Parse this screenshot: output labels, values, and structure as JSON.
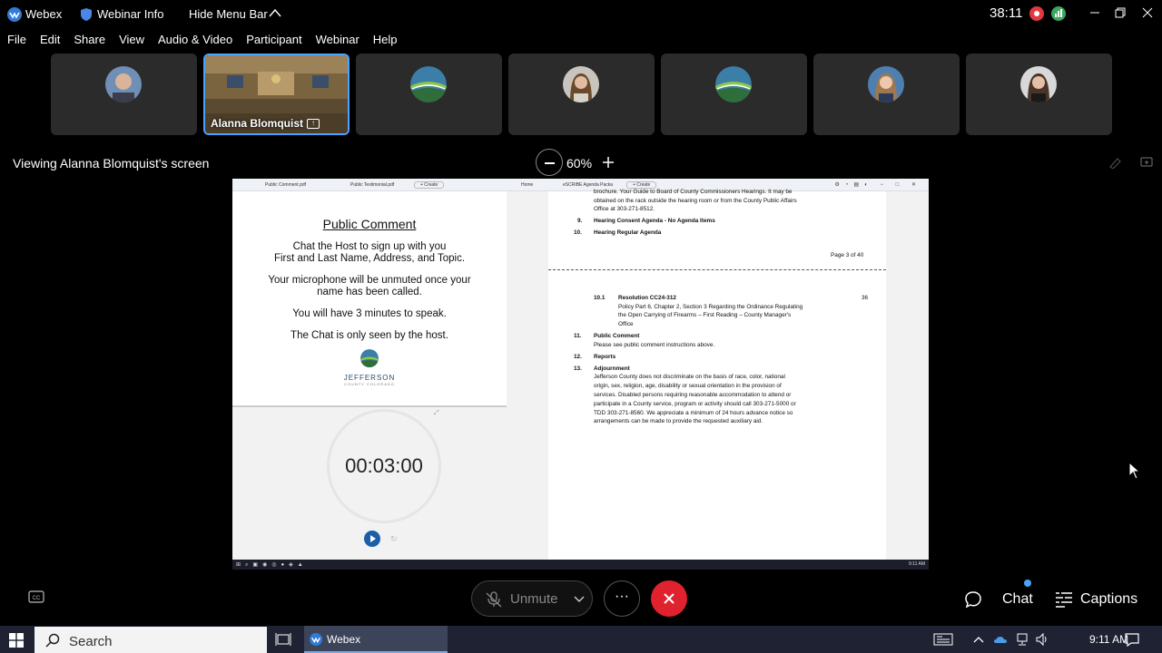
{
  "titlebar": {
    "app_name": "Webex",
    "webinar_info": "Webinar Info",
    "hide_menu": "Hide Menu Bar",
    "elapsed": "38:11"
  },
  "menu": [
    "File",
    "Edit",
    "Share",
    "View",
    "Audio & Video",
    "Participant",
    "Webinar",
    "Help"
  ],
  "participants": {
    "active_name": "Alanna Blomquist"
  },
  "share_view": {
    "viewing_label": "Viewing Alanna Blomquist's screen",
    "zoom": "60%"
  },
  "shared_screen": {
    "left_tabs": [
      "Public Comment.pdf",
      "Public Testimonial.pdf",
      "+ Create"
    ],
    "right_tabs": [
      "Home",
      "eSCRIBE Agenda Packa",
      "+ Create"
    ],
    "public_comment": {
      "title": "Public Comment",
      "p1_l1": "Chat the Host to sign up with you",
      "p1_l2": "First and Last Name, Address, and Topic.",
      "p2_l1": "Your microphone will be unmuted once your",
      "p2_l2": "name has been called.",
      "p3": "You will have 3 minutes to speak.",
      "p4": "The Chat is only seen by the host.",
      "logo_name": "JEFFERSON",
      "logo_sub": "COUNTY COLORADO"
    },
    "timer": "00:03:00",
    "agenda": {
      "top_l1": "brochure.   Your Guide to Board of County Commissioners Hearings.  It may be",
      "top_l2": "obtained on the rack outside the hearing room or from the County Public Affairs",
      "top_l3": "Office at 303-271-8512.",
      "item9_num": "9.",
      "item9": "Hearing Consent Agenda - No Agenda Items",
      "item10_num": "10.",
      "item10": "Hearing Regular Agenda",
      "page": "Page 3 of 40",
      "item101_num": "10.1",
      "item101_title": "Resolution CC24-312",
      "item101_page": "36",
      "item101_l1": "Policy Part 6, Chapter 2, Section 3 Regarding the Ordinance Regulating",
      "item101_l2": "the Open Carrying of Firearms – First Reading – County Manager's",
      "item101_l3": "Office",
      "item11_num": "11.",
      "item11": "Public Comment",
      "item11_sub": "Please see public comment instructions above.",
      "item12_num": "12.",
      "item12": "Reports",
      "item13_num": "13.",
      "item13": "Adjournment",
      "adj_l1": "Jefferson County does not discriminate on the basis of race, color, national",
      "adj_l2": "origin, sex, religion, age, disability or sexual orientation in the provision of",
      "adj_l3": "services.  Disabled persons requiring reasonable accommodation to attend or",
      "adj_l4": "participate in a County service, program or activity should call 303-271-5000 or",
      "adj_l5": "TDD 303-271-8560.  We appreciate a minimum of 24 hours advance notice so",
      "adj_l6": "arrangements can be made to provide the requested auxiliary aid."
    },
    "inner_clock": "9:11 AM"
  },
  "controls": {
    "unmute": "Unmute",
    "more": "···",
    "chat": "Chat",
    "captions": "Captions"
  },
  "taskbar": {
    "search_placeholder": "Search",
    "webex_label": "Webex",
    "time": "9:11 AM"
  },
  "colors": {
    "leave": "#e0222f",
    "accent": "#4aa3ff",
    "record": "#e2393f",
    "stats": "#3aa85f"
  }
}
